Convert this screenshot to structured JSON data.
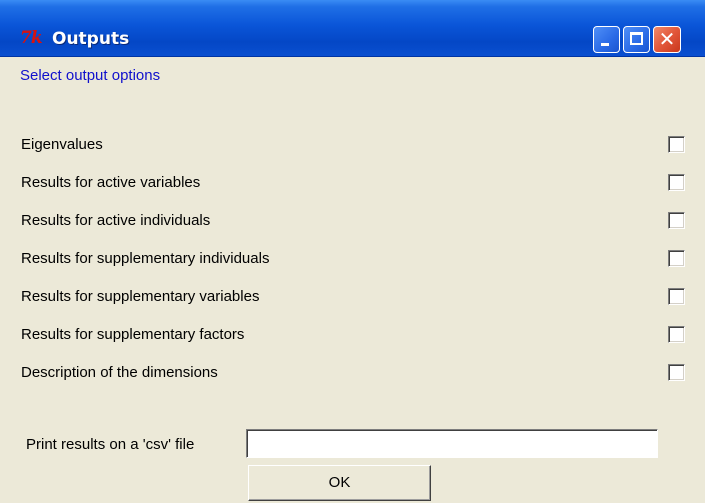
{
  "window": {
    "title": "Outputs",
    "logo_text": "7k",
    "close_glyph": "✕"
  },
  "header": "Select output options",
  "options": [
    {
      "label": "Eigenvalues",
      "checked": false
    },
    {
      "label": "Results for active variables",
      "checked": false
    },
    {
      "label": "Results for active individuals",
      "checked": false
    },
    {
      "label": "Results for supplementary individuals",
      "checked": false
    },
    {
      "label": "Results for supplementary variables",
      "checked": false
    },
    {
      "label": "Results for supplementary factors",
      "checked": false
    },
    {
      "label": "Description of the dimensions",
      "checked": false
    }
  ],
  "csv": {
    "label": "Print results on a 'csv' file",
    "value": ""
  },
  "ok_label": "OK",
  "colors": {
    "titlebar": "#0a55d8",
    "header_text": "#1010cc",
    "close_button": "#e2573a",
    "window_bg": "#ece9d8"
  }
}
